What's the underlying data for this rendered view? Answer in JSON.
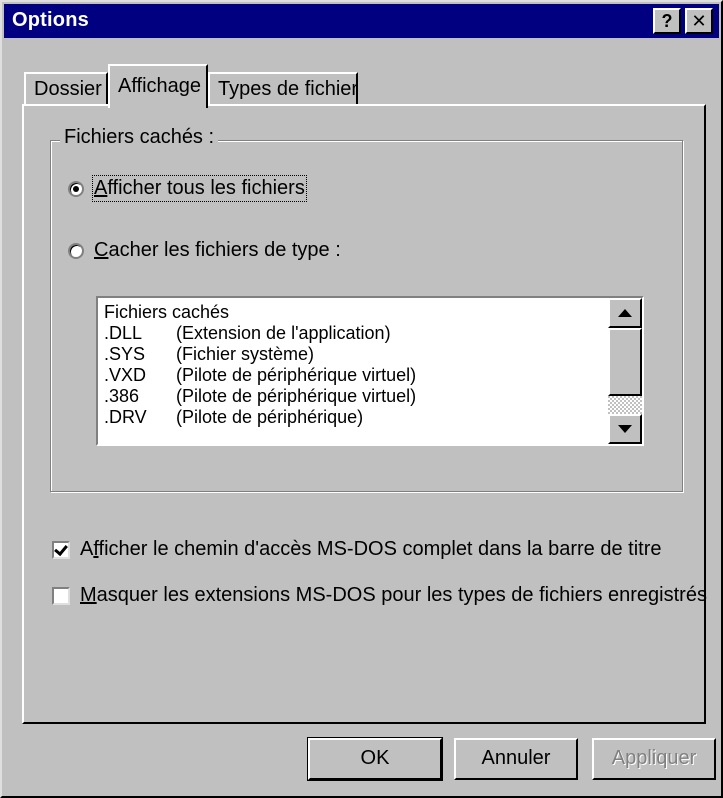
{
  "window": {
    "title": "Options",
    "help_label": "?",
    "close_label": "✕"
  },
  "tabs": [
    {
      "label": "Dossier",
      "active": false
    },
    {
      "label": "Affichage",
      "active": true
    },
    {
      "label": "Types de fichier",
      "active": false
    }
  ],
  "hidden_files": {
    "group_label": "Fichiers cachés :",
    "option_show_all": {
      "accel": "A",
      "rest": "fficher tous les fichiers",
      "checked": true
    },
    "option_hide_types": {
      "accel": "C",
      "rest": "acher les fichiers de type :",
      "checked": false
    },
    "list": {
      "header": "Fichiers cachés",
      "rows": [
        {
          "ext": ".DLL",
          "desc": "(Extension de l'application)"
        },
        {
          "ext": ".SYS",
          "desc": "(Fichier système)"
        },
        {
          "ext": ".VXD",
          "desc": "(Pilote de périphérique virtuel)"
        },
        {
          "ext": ".386",
          "desc": "(Pilote de périphérique virtuel)"
        },
        {
          "ext": ".DRV",
          "desc": "(Pilote de périphérique)"
        }
      ]
    }
  },
  "checkboxes": {
    "show_full_path": {
      "pre": "A",
      "accel": "f",
      "rest": "ficher le chemin d'accès MS-DOS complet dans la barre de titre",
      "checked": true
    },
    "hide_extensions": {
      "pre": "",
      "accel": "M",
      "rest": "asquer les extensions MS-DOS pour les types de fichiers enregistrés",
      "checked": false
    }
  },
  "buttons": {
    "ok": "OK",
    "cancel": "Annuler",
    "apply": "Appliquer"
  }
}
